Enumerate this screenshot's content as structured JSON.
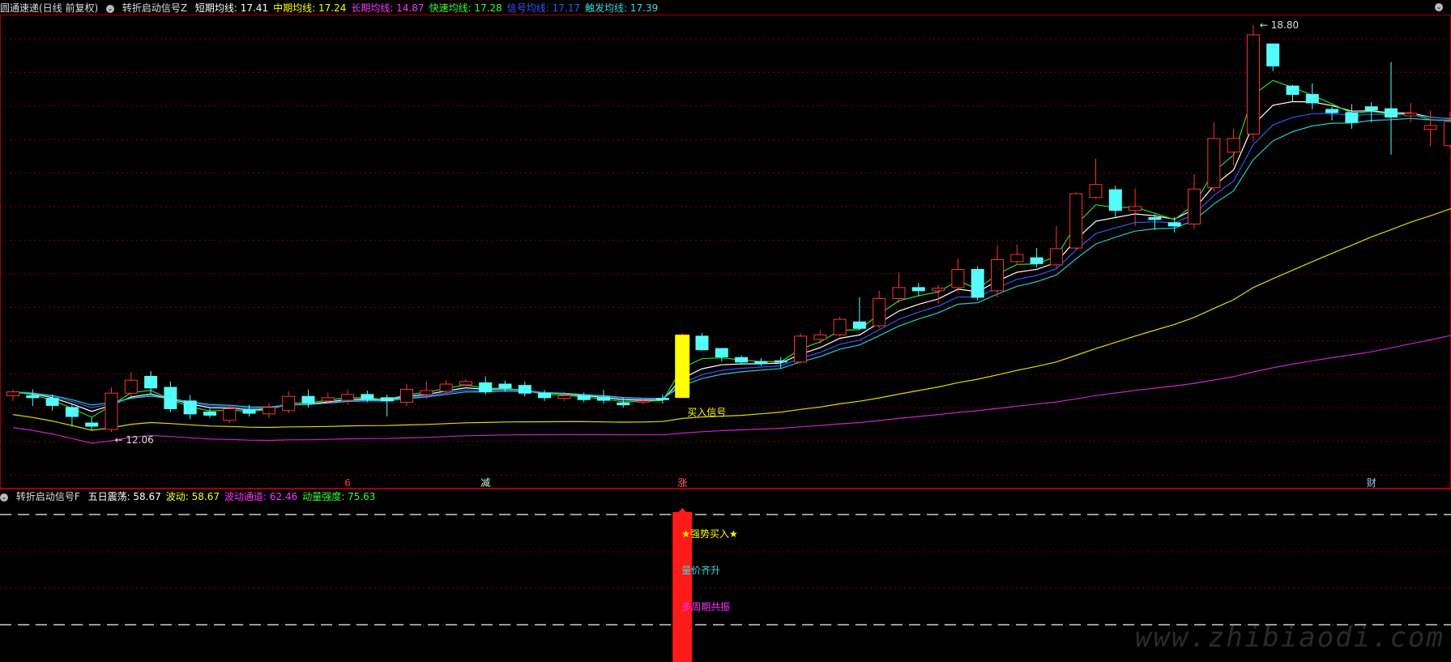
{
  "header_top": {
    "security": "圆通速递(日线 前复权)",
    "indicator": "转折启动信号Z",
    "items": [
      {
        "label": "短期均线:",
        "value": "17.41",
        "color": "#ffffff"
      },
      {
        "label": "中期均线:",
        "value": "17.24",
        "color": "#ffff00"
      },
      {
        "label": "长期均线:",
        "value": "14.87",
        "color": "#ff33ff"
      },
      {
        "label": "快速均线:",
        "value": "17.28",
        "color": "#33ff33"
      },
      {
        "label": "信号均线:",
        "value": "17.17",
        "color": "#3355ff"
      },
      {
        "label": "触发均线:",
        "value": "17.39",
        "color": "#33dddd"
      }
    ]
  },
  "header_bottom": {
    "indicator": "转折启动信号F",
    "items": [
      {
        "label": "五日震荡:",
        "value": "58.67",
        "color": "#ffffff"
      },
      {
        "label": "波动:",
        "value": "58.67",
        "color": "#ffff00"
      },
      {
        "label": "波动通道:",
        "value": "62.46",
        "color": "#ff33ff"
      },
      {
        "label": "动量强度:",
        "value": "75.63",
        "color": "#33ff33"
      }
    ]
  },
  "main_labels": {
    "high": "18.80",
    "low": "12.06",
    "buy_signal": "买入信号"
  },
  "date_markers": [
    {
      "text": "6",
      "color": "#ff3333",
      "index": 17
    },
    {
      "text": "减",
      "color": "#ccffcc",
      "index": 24
    },
    {
      "text": "涨",
      "color": "#ff6666",
      "index": 34
    },
    {
      "text": "财",
      "color": "#99ccff",
      "index": 69
    }
  ],
  "sub_labels": {
    "strong_buy": "★强势买入★",
    "volume_price": "量价齐升",
    "multi_cycle": "多周期共振"
  },
  "watermark": "www.zhibiaodi.com",
  "colors": {
    "up": "#ff3232",
    "down": "#54fcfc",
    "grid": "#800000",
    "bg": "#000000"
  },
  "chart_data": {
    "type": "candlestick",
    "y_range": [
      12.06,
      18.8
    ],
    "candles": [
      [
        13.08,
        13.14,
        13.18,
        13.0
      ],
      [
        13.08,
        13.05,
        13.18,
        12.92
      ],
      [
        13.04,
        12.93,
        13.1,
        12.85
      ],
      [
        12.9,
        12.76,
        12.96,
        12.6
      ],
      [
        12.66,
        12.61,
        12.74,
        12.55
      ],
      [
        12.56,
        13.12,
        13.21,
        12.52
      ],
      [
        13.12,
        13.32,
        13.44,
        13.07
      ],
      [
        13.38,
        13.2,
        13.46,
        13.1
      ],
      [
        13.21,
        12.88,
        13.3,
        12.83
      ],
      [
        13.0,
        12.8,
        13.09,
        12.72
      ],
      [
        12.83,
        12.78,
        12.88,
        12.74
      ],
      [
        12.7,
        12.88,
        12.95,
        12.66
      ],
      [
        12.87,
        12.81,
        12.94,
        12.76
      ],
      [
        12.8,
        12.9,
        12.96,
        12.74
      ],
      [
        12.85,
        13.07,
        13.15,
        12.81
      ],
      [
        13.07,
        12.97,
        13.17,
        12.9
      ],
      [
        13.0,
        13.05,
        13.13,
        12.96
      ],
      [
        13.01,
        13.1,
        13.18,
        12.94
      ],
      [
        13.1,
        13.03,
        13.16,
        12.98
      ],
      [
        13.05,
        13.0,
        13.1,
        12.76
      ],
      [
        12.98,
        13.18,
        13.26,
        12.92
      ],
      [
        13.1,
        13.16,
        13.3,
        13.03
      ],
      [
        13.15,
        13.26,
        13.32,
        13.1
      ],
      [
        13.25,
        13.3,
        13.34,
        13.2
      ],
      [
        13.28,
        13.14,
        13.38,
        13.1
      ],
      [
        13.26,
        13.2,
        13.31,
        13.14
      ],
      [
        13.24,
        13.12,
        13.3,
        13.07
      ],
      [
        13.12,
        13.05,
        13.17,
        13.0
      ],
      [
        13.04,
        13.08,
        13.14,
        13.0
      ],
      [
        13.08,
        13.02,
        13.13,
        12.98
      ],
      [
        13.06,
        13.01,
        13.17,
        12.96
      ],
      [
        12.97,
        12.94,
        13.05,
        12.9
      ],
      [
        12.98,
        13.0,
        13.05,
        12.95
      ],
      [
        13.04,
        13.02,
        13.1,
        12.96
      ],
      [
        13.05,
        14.02,
        14.05,
        13.05
      ],
      [
        14.0,
        13.79,
        14.05,
        13.77
      ],
      [
        13.81,
        13.68,
        13.82,
        13.61
      ],
      [
        13.67,
        13.6,
        13.7,
        13.56
      ],
      [
        13.61,
        13.58,
        13.66,
        13.54
      ],
      [
        13.62,
        13.6,
        13.68,
        13.5
      ],
      [
        13.6,
        14.0,
        14.05,
        13.58
      ],
      [
        13.95,
        14.02,
        14.1,
        13.88
      ],
      [
        14.02,
        14.26,
        14.3,
        13.99
      ],
      [
        14.22,
        14.12,
        14.6,
        14.1
      ],
      [
        14.16,
        14.58,
        14.7,
        14.12
      ],
      [
        14.58,
        14.75,
        14.98,
        14.51
      ],
      [
        14.75,
        14.7,
        14.82,
        14.62
      ],
      [
        14.7,
        14.74,
        14.79,
        14.5
      ],
      [
        14.75,
        15.03,
        15.2,
        14.68
      ],
      [
        15.03,
        14.6,
        15.08,
        14.55
      ],
      [
        14.7,
        15.18,
        15.4,
        14.6
      ],
      [
        15.15,
        15.26,
        15.41,
        15.1
      ],
      [
        15.21,
        15.12,
        15.36,
        15.06
      ],
      [
        15.1,
        15.35,
        15.7,
        15.05
      ],
      [
        15.36,
        16.2,
        16.22,
        15.34
      ],
      [
        16.14,
        16.34,
        16.74,
        16.12
      ],
      [
        16.26,
        15.94,
        16.32,
        15.84
      ],
      [
        15.94,
        16.0,
        16.28,
        15.7
      ],
      [
        15.83,
        15.8,
        15.88,
        15.64
      ],
      [
        15.75,
        15.7,
        15.84,
        15.6
      ],
      [
        15.73,
        16.27,
        16.5,
        15.65
      ],
      [
        16.29,
        17.05,
        17.3,
        16.23
      ],
      [
        16.84,
        17.05,
        17.2,
        16.64
      ],
      [
        17.12,
        18.65,
        18.8,
        17.0
      ],
      [
        18.51,
        18.17,
        18.51,
        18.09
      ],
      [
        17.86,
        17.73,
        17.88,
        17.62
      ],
      [
        17.73,
        17.6,
        17.9,
        17.5
      ],
      [
        17.5,
        17.45,
        17.54,
        17.33
      ],
      [
        17.45,
        17.3,
        17.58,
        17.2
      ],
      [
        17.54,
        17.49,
        17.61,
        17.3
      ],
      [
        17.51,
        17.38,
        18.23,
        16.8
      ],
      [
        17.4,
        17.44,
        17.6,
        17.3
      ],
      [
        17.19,
        17.25,
        17.48,
        16.93
      ],
      [
        16.94,
        17.31,
        17.46,
        16.9
      ],
      [
        17.12,
        17.56,
        17.88,
        16.92
      ]
    ],
    "sub_panel": {
      "signal_bar_index": 34
    }
  }
}
